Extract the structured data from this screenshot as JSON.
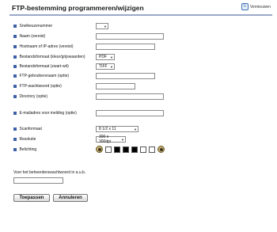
{
  "title": "FTP-bestemming programmeren/wijzigen",
  "refresh_label": "Vernieuwen",
  "icons": {
    "refresh": "refresh-icon",
    "bullet": "square-bullet",
    "colour_picker": "colour-picker-icon"
  },
  "fields": [
    {
      "label": "Snelkeuzenummer",
      "value": ""
    },
    {
      "label": "Naam (vereist)",
      "value": ""
    },
    {
      "label": "Hostnaam of IP-adres (vereist)",
      "value": ""
    },
    {
      "label": "Bestandsformaat (kleur/grijswaarden)",
      "value": "PDF"
    },
    {
      "label": "Bestandsformaat (zwart-wit)",
      "value": "TIFF"
    },
    {
      "label": "FTP-gebruikersnaam (optie)",
      "value": ""
    },
    {
      "label": "FTP-wachtwoord (optie)",
      "value": ""
    },
    {
      "label": "Directory (optie)",
      "value": ""
    },
    {
      "label": "E-mailadres voor melding (optie)",
      "value": ""
    },
    {
      "label": "Scanformaat",
      "value": "8 1/2 x 11"
    },
    {
      "label": "Resolutie",
      "value": "300 x 300dpi"
    },
    {
      "label": "Belichting",
      "value": ""
    }
  ],
  "exposure_colors": [
    "#ffffff",
    "#000000",
    "#000000",
    "#000000",
    "#ffffff",
    "#ffffff"
  ],
  "admin_password_label": "Voer het beheerderswachtwoord in a.u.b.",
  "buttons": {
    "apply": "Toepassen",
    "cancel": "Annuleren"
  }
}
